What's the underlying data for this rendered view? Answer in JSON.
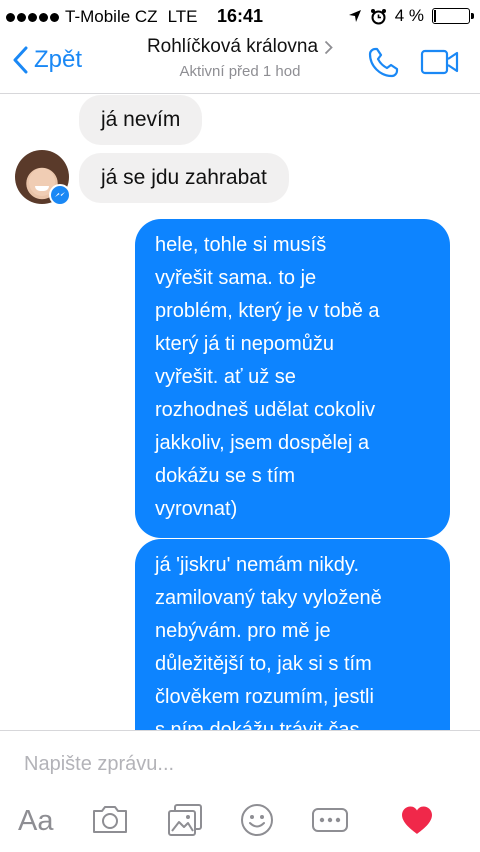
{
  "status_bar": {
    "carrier": "T-Mobile CZ",
    "network": "LTE",
    "time": "16:41",
    "battery": "4 %",
    "battery_level": 0.04
  },
  "header": {
    "back_label": "Zpět",
    "contact_name": "Rohlíčková královna",
    "status": "Aktivní před 1 hod"
  },
  "messages": {
    "incoming": [
      "já nevím",
      "já se jdu zahrabat"
    ],
    "outgoing": [
      [
        "hele, tohle si musíš",
        "vyřešit sama. to je",
        "problém, který je v tobě a",
        "který já ti nepomůžu",
        "vyřešit. ať už se",
        "rozhodneš udělat cokoliv",
        "jakkoliv, jsem dospělej a",
        "dokážu se s tím",
        "vyrovnat)"
      ],
      [
        "já 'jiskru' nemám nikdy.",
        "zamilovaný taky vyloženě",
        "nebývám. pro mě je",
        "důležitější to, jak si s tím",
        "člověkem rozumím, jestli",
        "s ním dokážu trávit čas"
      ]
    ]
  },
  "composer": {
    "placeholder": "Napište zprávu...",
    "aa_label": "Aa"
  },
  "colors": {
    "accent": "#1a88f5",
    "outgoing_bubble": "#0d84ff",
    "incoming_bubble": "#f1f0f0",
    "heart": "#f0284a"
  },
  "icons": [
    "back-chevron-icon",
    "phone-icon",
    "video-camera-icon",
    "messenger-badge-icon",
    "camera-icon",
    "gallery-icon",
    "sticker-smile-icon",
    "more-icon",
    "heart-icon"
  ]
}
